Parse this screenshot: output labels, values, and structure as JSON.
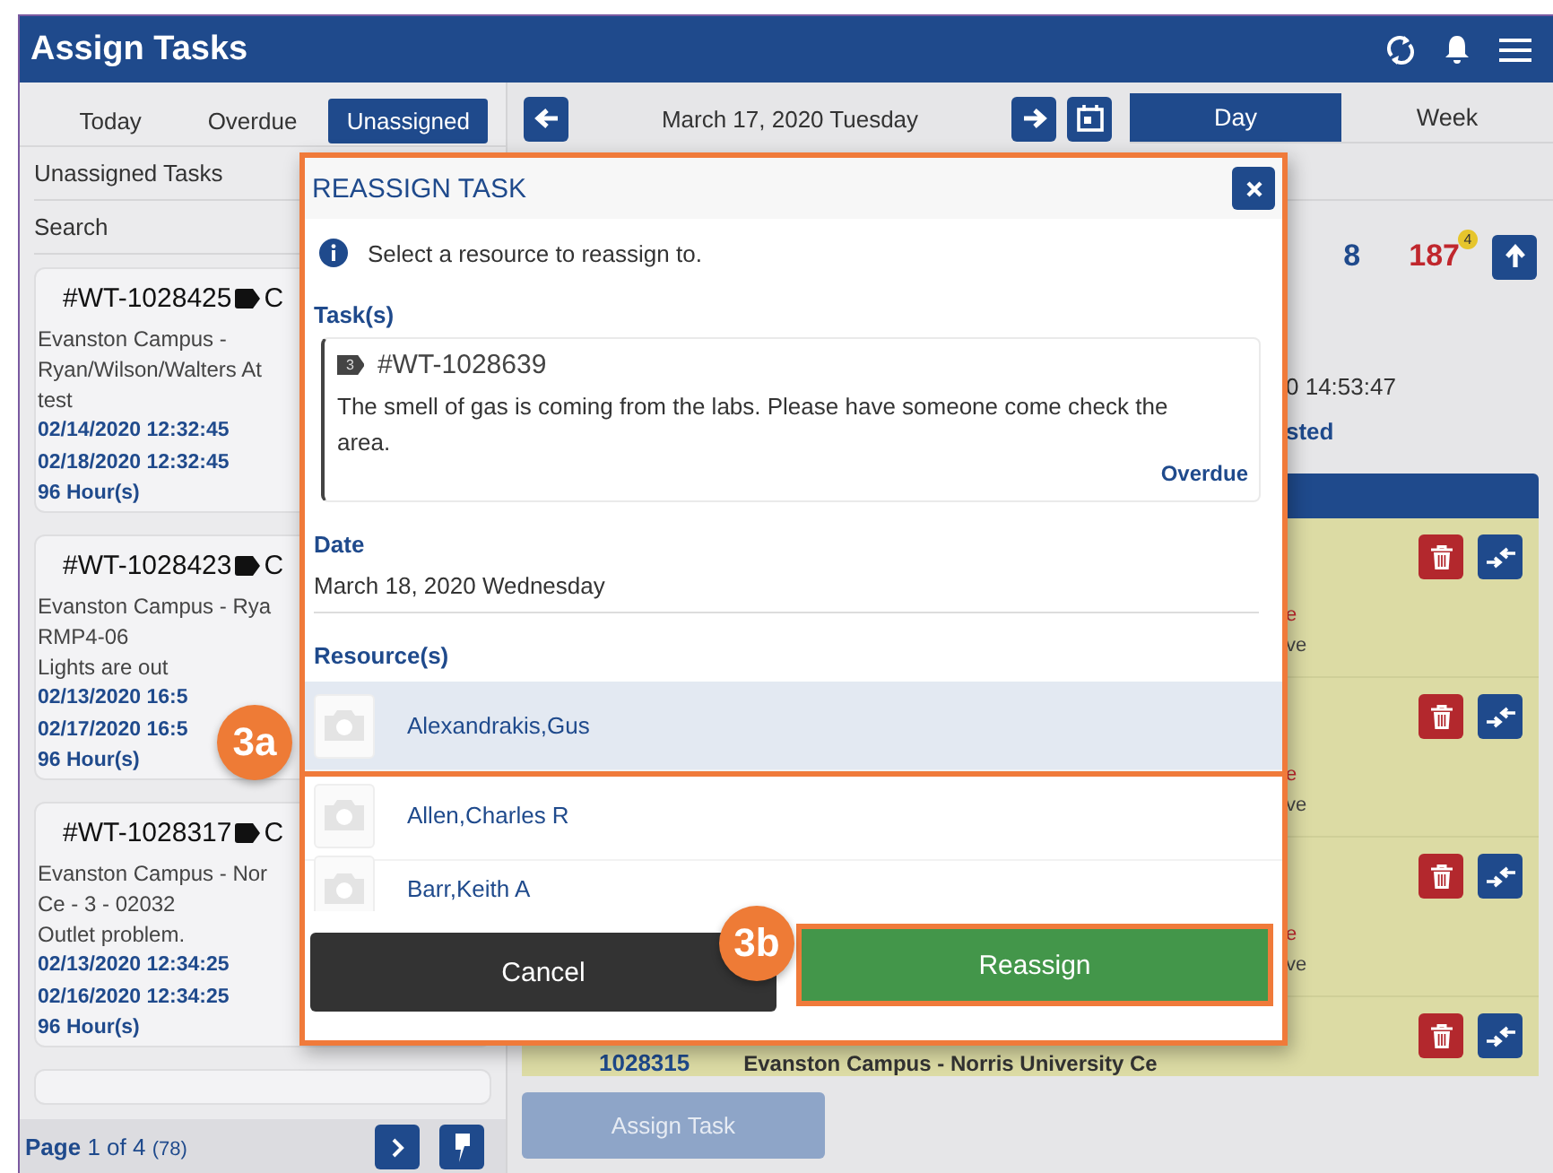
{
  "header": {
    "title": "Assign Tasks"
  },
  "left": {
    "tabs": [
      {
        "label": "Today",
        "selected": false
      },
      {
        "label": "Overdue",
        "selected": false
      },
      {
        "label": "Unassigned",
        "selected": true
      }
    ],
    "list_title": "Unassigned Tasks",
    "search": {
      "placeholder": "Search"
    },
    "cards": [
      {
        "id": "#WT-1028425",
        "code": "C",
        "lines": [
          "Evanston Campus -",
          "Ryan/Wilson/Walters At",
          "test"
        ],
        "dates": [
          "02/14/2020 12:32:45",
          "02/18/2020 12:32:45"
        ],
        "duration": "96 Hour(s)"
      },
      {
        "id": "#WT-1028423",
        "code": "C",
        "lines": [
          "Evanston Campus - Rya",
          "RMP4-06",
          "Lights are out"
        ],
        "dates": [
          "02/13/2020 16:5",
          "02/17/2020 16:5"
        ],
        "duration": "96 Hour(s)"
      },
      {
        "id": "#WT-1028317",
        "code": "C",
        "lines": [
          "Evanston Campus - Nor",
          "Ce - 3 - 02032",
          "Outlet problem."
        ],
        "dates": [
          "02/13/2020 12:34:25",
          "02/16/2020 12:34:25"
        ],
        "duration": "96 Hour(s)"
      }
    ],
    "pager": {
      "label": "Page",
      "pages": "1 of 4",
      "total": "(78)"
    }
  },
  "right": {
    "date": "March 17, 2020 Tuesday",
    "views": [
      {
        "label": "Day",
        "selected": true
      },
      {
        "label": "Week",
        "selected": false
      }
    ],
    "stats": {
      "count": "8",
      "overdue": "187",
      "badge": "4"
    },
    "time": "0 14:53:47",
    "status": "sted",
    "rows": [
      {
        "status": "e",
        "note": "ve"
      },
      {
        "status": "e",
        "note": "ve"
      },
      {
        "status": "e",
        "note": "ve"
      },
      {
        "number": "1028315",
        "location": "Evanston Campus - Norris University Ce"
      }
    ],
    "assign_button": {
      "label": "Assign Task",
      "disabled": true
    }
  },
  "modal": {
    "title": "REASSIGN TASK",
    "info": "Select a resource to reassign to.",
    "tasks_label": "Task(s)",
    "task": {
      "priority": "3",
      "id": "#WT-1028639",
      "description": "The smell of gas is coming from the labs. Please have someone come check the area.",
      "status": "Overdue"
    },
    "date_label": "Date",
    "date": "March 18, 2020 Wednesday",
    "resources_label": "Resource(s)",
    "resources": [
      {
        "name": "Alexandrakis,Gus",
        "selected": true
      },
      {
        "name": "Allen,Charles R",
        "selected": false
      },
      {
        "name": "Barr,Keith A",
        "selected": false
      }
    ],
    "cancel": "Cancel",
    "confirm": "Reassign"
  },
  "callouts": [
    {
      "label": "3a"
    },
    {
      "label": "3b"
    }
  ]
}
